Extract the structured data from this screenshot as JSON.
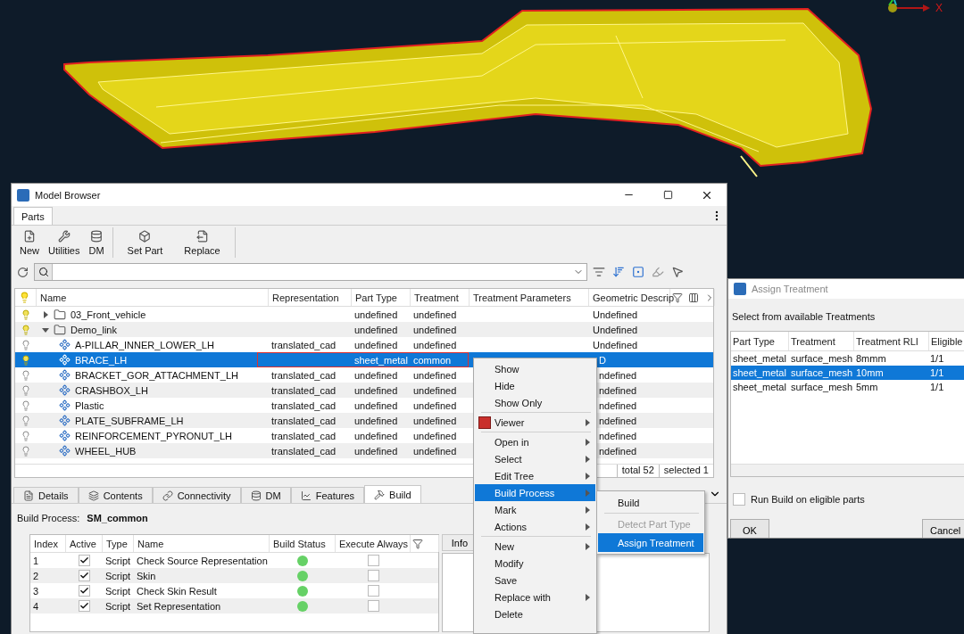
{
  "viewport": {
    "axis_label": "X"
  },
  "model_browser": {
    "title": "Model Browser",
    "tabs": [
      {
        "label": "Parts",
        "selected": true
      }
    ],
    "toolbar": [
      {
        "label": "New"
      },
      {
        "label": "Utilities"
      },
      {
        "label": "DM"
      },
      {
        "label": "Set Part"
      },
      {
        "label": "Replace"
      }
    ],
    "columns": [
      "Name",
      "Representation",
      "Part Type",
      "Treatment",
      "Treatment Parameters",
      "Geometric Descrip"
    ],
    "tree": [
      {
        "name": "03_Front_vehicle",
        "visible": true,
        "expanded": false,
        "selected": false,
        "part_type": "undefined",
        "treatment": "undefined",
        "geometric": "Undefined"
      },
      {
        "name": "Demo_link",
        "visible": true,
        "expanded": true,
        "selected": false,
        "part_type": "undefined",
        "treatment": "undefined",
        "geometric": "Undefined",
        "children": [
          {
            "name": "A-PILLAR_INNER_LOWER_LH",
            "visible": false,
            "selected": false,
            "representation": "translated_cad",
            "part_type": "undefined",
            "treatment": "undefined",
            "geometric": "Undefined"
          },
          {
            "name": "BRACE_LH",
            "visible": true,
            "selected": true,
            "outlined": true,
            "part_type": "sheet_metal",
            "treatment": "common",
            "geometric": "D"
          },
          {
            "name": "BRACKET_GOR_ATTACHMENT_LH",
            "visible": false,
            "selected": false,
            "representation": "translated_cad",
            "part_type": "undefined",
            "treatment": "undefined",
            "geometric": "ndefined"
          },
          {
            "name": "CRASHBOX_LH",
            "visible": false,
            "selected": false,
            "representation": "translated_cad",
            "part_type": "undefined",
            "treatment": "undefined",
            "geometric": "ndefined"
          },
          {
            "name": "Plastic",
            "visible": false,
            "selected": false,
            "representation": "translated_cad",
            "part_type": "undefined",
            "treatment": "undefined",
            "geometric": "ndefined"
          },
          {
            "name": "PLATE_SUBFRAME_LH",
            "visible": false,
            "selected": false,
            "representation": "translated_cad",
            "part_type": "undefined",
            "treatment": "undefined",
            "geometric": "ndefined"
          },
          {
            "name": "REINFORCEMENT_PYRONUT_LH",
            "visible": false,
            "selected": false,
            "representation": "translated_cad",
            "part_type": "undefined",
            "treatment": "undefined",
            "geometric": "ndefined"
          },
          {
            "name": "WHEEL_HUB",
            "visible": false,
            "selected": false,
            "representation": "translated_cad",
            "part_type": "undefined",
            "treatment": "undefined",
            "geometric": "ndefined"
          }
        ]
      }
    ],
    "status": [
      "total 52",
      "selected 1"
    ],
    "bottom_tabs": [
      {
        "label": "Details",
        "selected": false
      },
      {
        "label": "Contents",
        "selected": false
      },
      {
        "label": "Connectivity",
        "selected": false
      },
      {
        "label": "DM",
        "selected": false
      },
      {
        "label": "Features",
        "selected": false
      },
      {
        "label": "Build",
        "selected": true
      }
    ],
    "build_process": {
      "label": "Build Process:",
      "value": "SM_common"
    },
    "step_columns": [
      "Index",
      "Active",
      "Type",
      "Name",
      "Build Status",
      "Execute Always"
    ],
    "steps": [
      {
        "index": "1",
        "active": true,
        "type": "Script",
        "name": "Check Source Representation",
        "color": "#66d166",
        "execute_always": false
      },
      {
        "index": "2",
        "active": true,
        "type": "Script",
        "name": "Skin",
        "color": "#66d166",
        "execute_always": false
      },
      {
        "index": "3",
        "active": true,
        "type": "Script",
        "name": "Check Skin Result",
        "color": "#66d166",
        "execute_always": false
      },
      {
        "index": "4",
        "active": true,
        "type": "Script",
        "name": "Set Representation",
        "color": "#66d166",
        "execute_always": false
      }
    ],
    "info_tab": "Info"
  },
  "context_menu": {
    "groups": [
      [
        {
          "label": "Show",
          "submenu": false,
          "selected": false
        },
        {
          "label": "Hide",
          "submenu": false,
          "selected": false
        },
        {
          "label": "Show Only",
          "submenu": false,
          "selected": false
        }
      ],
      [
        {
          "label": "Viewer",
          "submenu": true,
          "selected": false,
          "kind": "icon"
        }
      ],
      [
        {
          "label": "Open in",
          "submenu": true,
          "selected": false
        },
        {
          "label": "Select",
          "submenu": true,
          "selected": false
        },
        {
          "label": "Edit Tree",
          "submenu": true,
          "selected": false
        },
        {
          "label": "Build Process",
          "submenu": true,
          "selected": true
        },
        {
          "label": "Mark",
          "submenu": true,
          "selected": false
        },
        {
          "label": "Actions",
          "submenu": true,
          "selected": false
        }
      ],
      [
        {
          "label": "New",
          "submenu": true,
          "selected": false
        },
        {
          "label": "Modify",
          "submenu": false,
          "selected": false
        },
        {
          "label": "Save",
          "submenu": false,
          "selected": false
        },
        {
          "label": "Replace with",
          "submenu": true,
          "selected": false
        },
        {
          "label": "Delete",
          "submenu": false,
          "selected": false
        }
      ]
    ]
  },
  "submenu": {
    "groups": [
      [
        {
          "label": "Build",
          "disabled": false,
          "selected": false
        }
      ],
      [
        {
          "label": "Detect Part Type",
          "disabled": true,
          "selected": false
        },
        {
          "label": "Assign Treatment",
          "disabled": false,
          "selected": true
        }
      ]
    ]
  },
  "dialog": {
    "title": "Assign Treatment",
    "prompt": "Select from available Treatments",
    "columns": [
      "Part Type",
      "Treatment",
      "Treatment RLI",
      "Eligible"
    ],
    "rows": [
      {
        "cells": [
          "sheet_metal",
          "surface_mesh",
          "8mmm",
          "1/1"
        ],
        "selected": false
      },
      {
        "cells": [
          "sheet_metal",
          "surface_mesh",
          "10mm",
          "1/1"
        ],
        "selected": true
      },
      {
        "cells": [
          "sheet_metal",
          "surface_mesh",
          "5mm",
          "1/1"
        ],
        "selected": false
      }
    ],
    "checkbox": {
      "label": "Run Build on eligible parts",
      "checked": false
    },
    "buttons": [
      "OK",
      "Cancel"
    ]
  }
}
